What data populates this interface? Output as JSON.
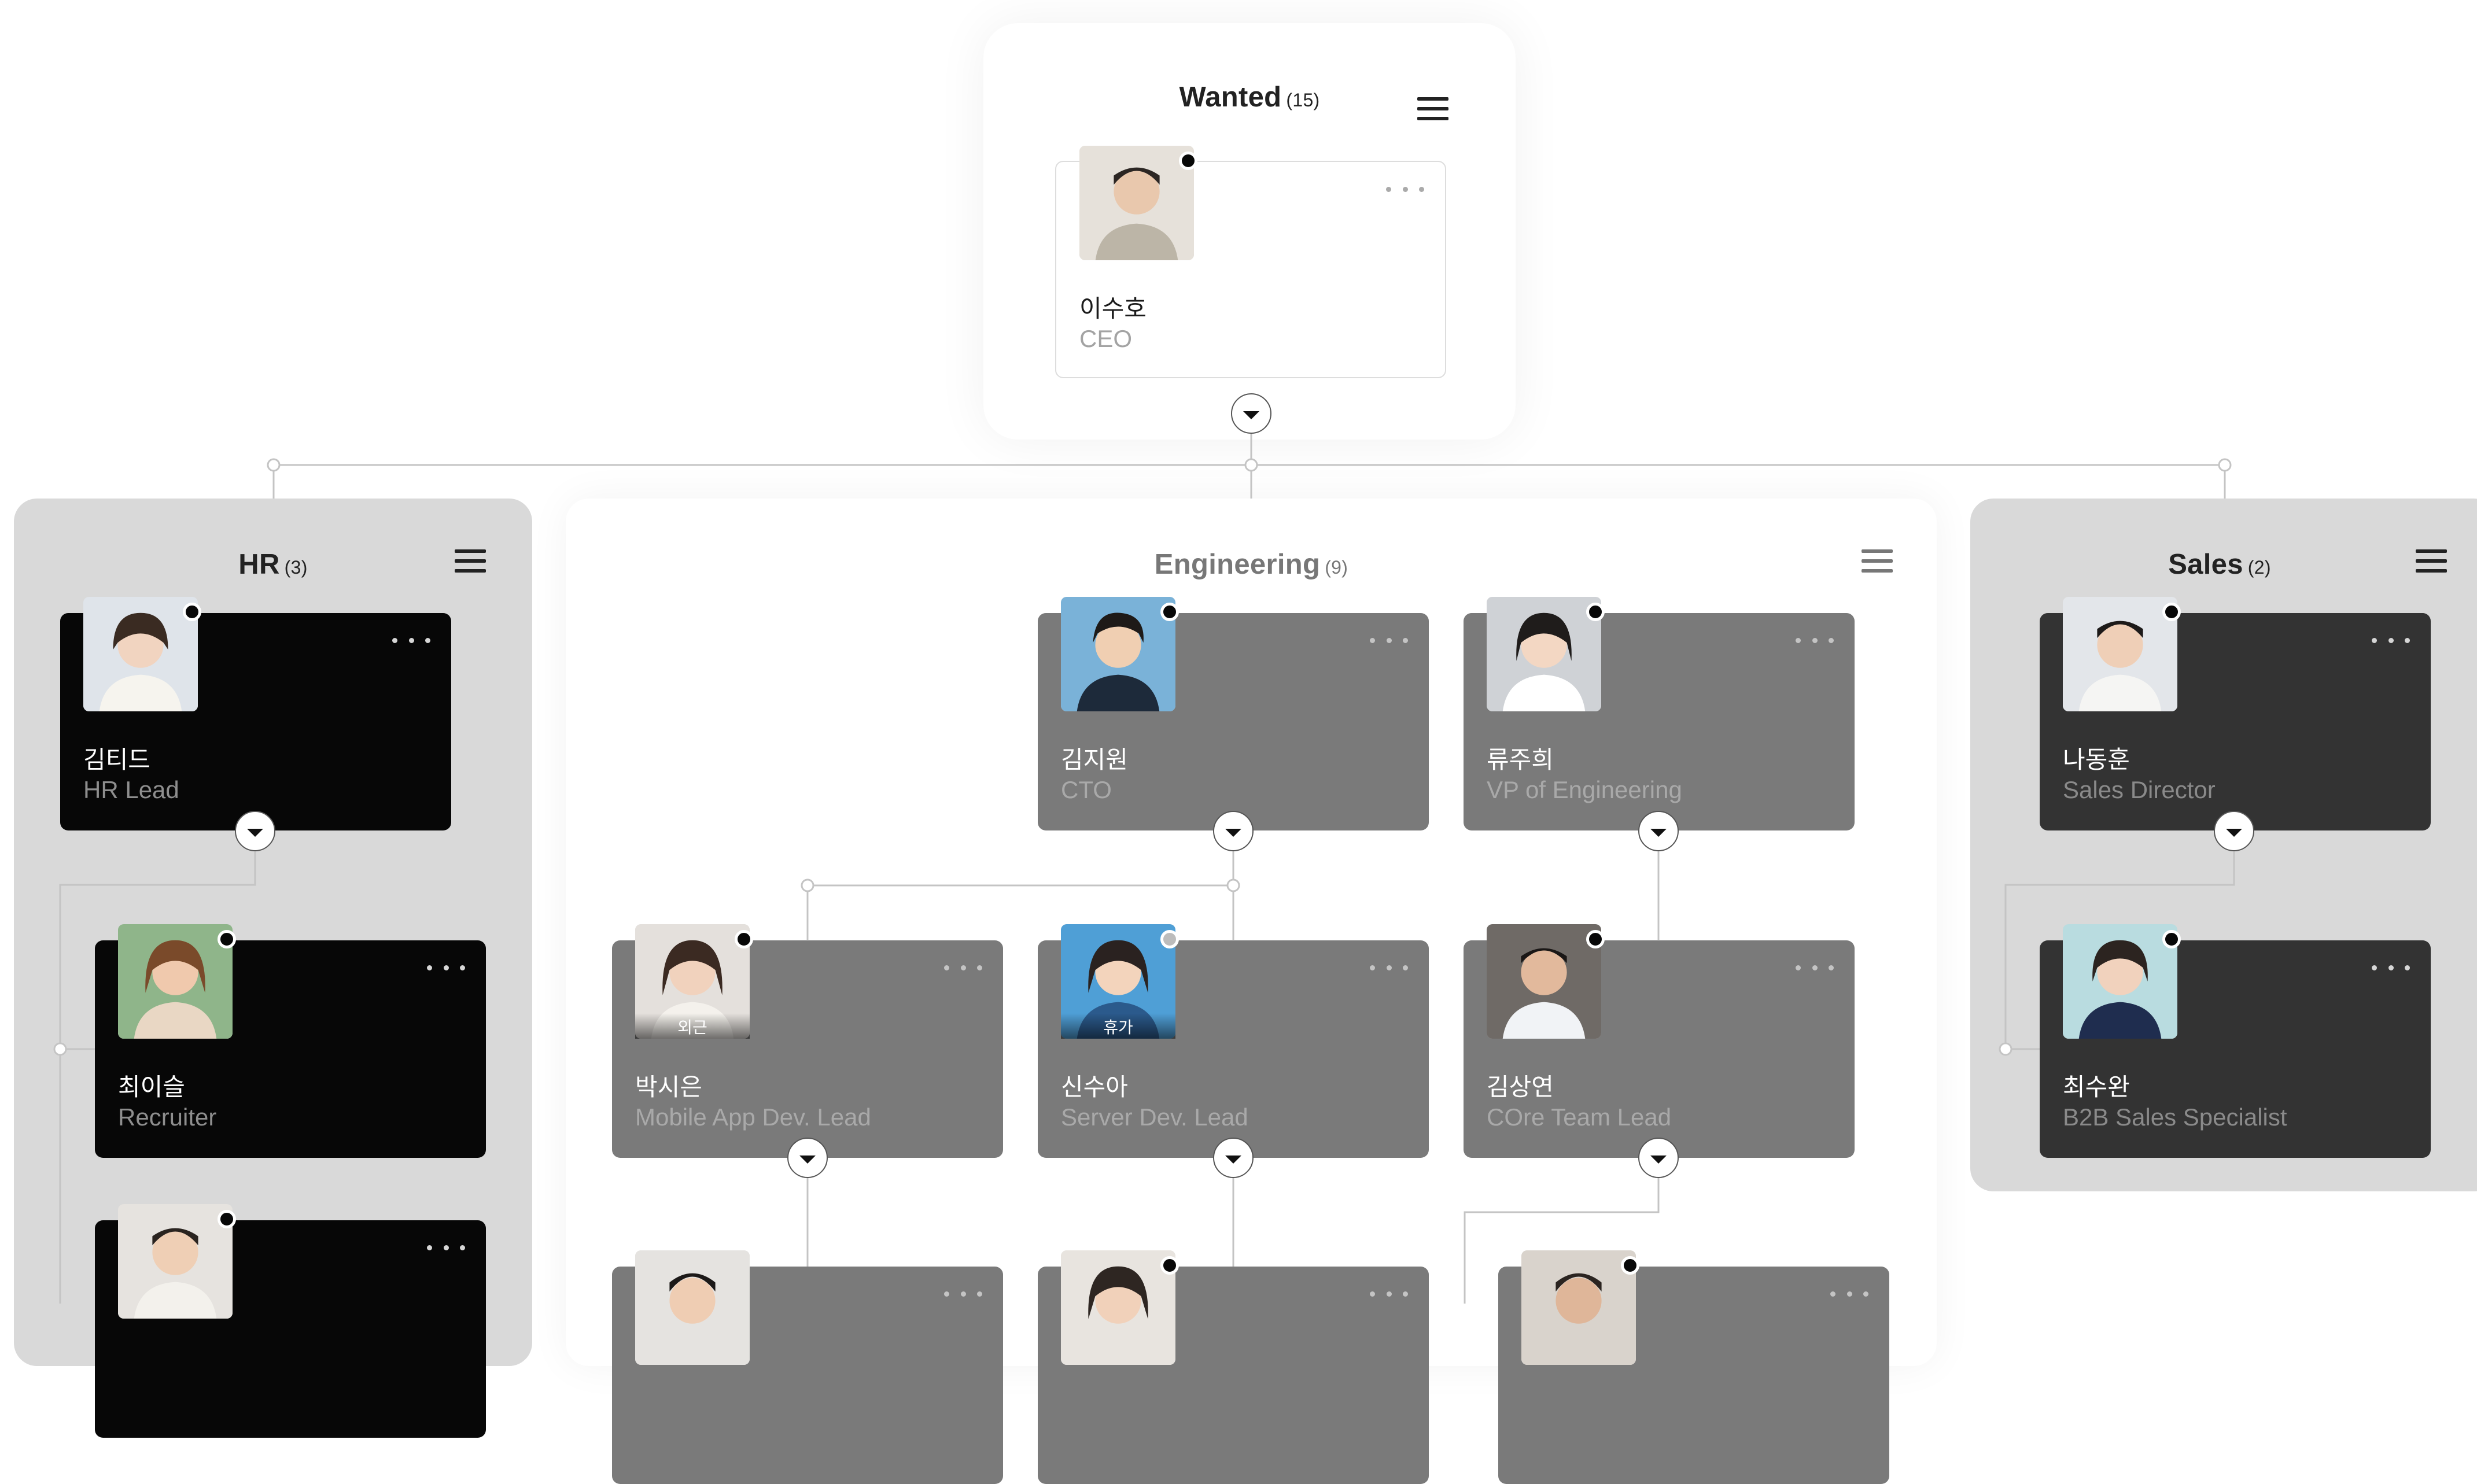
{
  "root": {
    "title": "Wanted",
    "count": "(15)",
    "member": {
      "name": "이수호",
      "role": "CEO"
    }
  },
  "groups": [
    {
      "title": "HR",
      "count": "(3)",
      "members": [
        {
          "name": "김티드",
          "role": "HR Lead"
        },
        {
          "name": "최이슬",
          "role": "Recruiter"
        },
        {
          "name": "",
          "role": ""
        }
      ]
    },
    {
      "title": "Engineering",
      "count": "(9)",
      "members": [
        {
          "name": "김지원",
          "role": "CTO"
        },
        {
          "name": "류주희",
          "role": "VP of Engineering"
        },
        {
          "name": "박시은",
          "role": "Mobile App Dev. Lead",
          "tag": "외근"
        },
        {
          "name": "신수아",
          "role": "Server Dev. Lead",
          "tag": "휴가"
        },
        {
          "name": "김상연",
          "role": "COre Team Lead"
        }
      ]
    },
    {
      "title": "Sales",
      "count": "(2)",
      "members": [
        {
          "name": "나동훈",
          "role": "Sales Director"
        },
        {
          "name": "최수완",
          "role": "B2B Sales Specialist"
        }
      ]
    }
  ],
  "colors": {
    "hr_panel": "#d9d9d9",
    "engineering_panel": "#ffffff",
    "sales_panel": "#d9d9d9",
    "hr_card": "#070707",
    "engineering_card": "#7a7a7a",
    "sales_card": "#333333",
    "connector": "#c4c4c4"
  },
  "icons": [
    "menu-icon",
    "more-icon",
    "chevron-down-icon",
    "presence-dot"
  ]
}
